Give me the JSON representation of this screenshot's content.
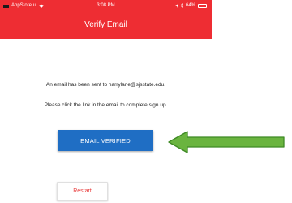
{
  "status_bar": {
    "carrier": "AppStore ııl",
    "time": "3:08 PM",
    "battery": "64%"
  },
  "header": {
    "title": "Verify Email"
  },
  "message": {
    "line1": "An email has been sent to harrylane@sjsstate.edu.",
    "line2": "Please click the link in the email to complete sign up."
  },
  "buttons": {
    "email_verified": "EMAIL VERIFIED",
    "restart": "Restart"
  },
  "annotation": {
    "arrow_color": "#6ab43f"
  },
  "colors": {
    "header": "#ee2d33",
    "primary_button": "#1f6ec4",
    "restart_text": "#e83a3a"
  }
}
